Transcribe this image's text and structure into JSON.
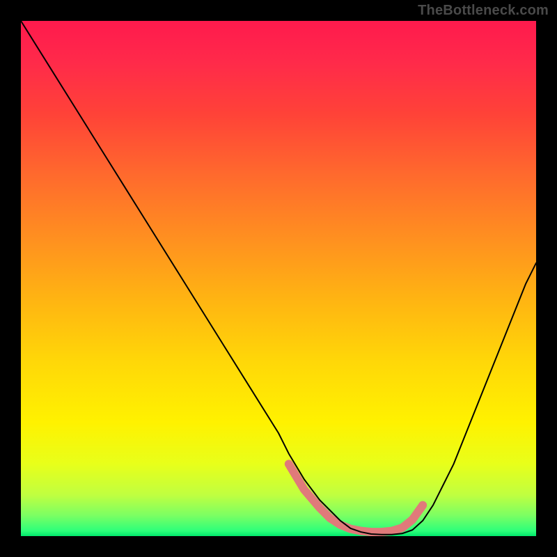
{
  "watermark": "TheBottleneck.com",
  "chart_data": {
    "type": "line",
    "title": "",
    "xlabel": "",
    "ylabel": "",
    "xlim": [
      0,
      100
    ],
    "ylim": [
      0,
      100
    ],
    "grid": false,
    "legend": false,
    "series": [
      {
        "name": "curve",
        "color": "#000000",
        "stroke_width": 2,
        "x": [
          0,
          5,
          10,
          15,
          20,
          25,
          30,
          35,
          40,
          45,
          50,
          52,
          55,
          58,
          60,
          62,
          64,
          66,
          68,
          70,
          72,
          74,
          76,
          78,
          80,
          82,
          84,
          86,
          88,
          90,
          92,
          94,
          96,
          98,
          100
        ],
        "y": [
          100,
          92,
          84,
          76,
          68,
          60,
          52,
          44,
          36,
          28,
          20,
          16,
          11,
          7,
          5,
          3,
          1.5,
          0.8,
          0.4,
          0.3,
          0.3,
          0.5,
          1.2,
          3,
          6,
          10,
          14,
          19,
          24,
          29,
          34,
          39,
          44,
          49,
          53
        ]
      },
      {
        "name": "highlight-band",
        "color": "#e07a7a",
        "stroke_width": 12,
        "x": [
          52,
          55,
          58,
          60,
          62,
          64,
          66,
          68,
          70,
          72,
          74,
          76,
          78
        ],
        "y": [
          14,
          9,
          5.5,
          3.5,
          2.2,
          1.4,
          1.0,
          0.8,
          0.8,
          1.0,
          1.6,
          3.2,
          6
        ]
      }
    ]
  }
}
